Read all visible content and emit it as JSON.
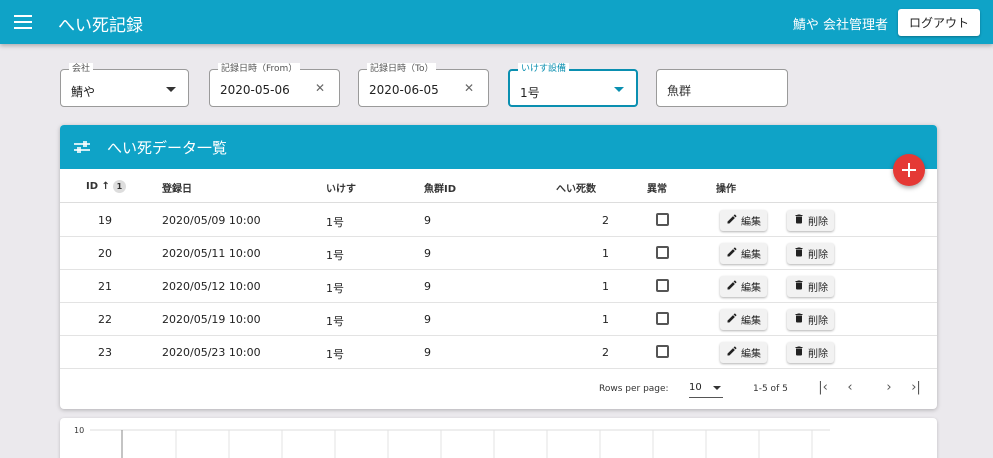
{
  "appbar": {
    "title": "へい死記録",
    "user": "鯖や 会社管理者",
    "logout_label": "ログアウト"
  },
  "filters": {
    "company": {
      "label": "会社",
      "value": "鯖や"
    },
    "date_from": {
      "label": "記録日時（From）",
      "value": "2020-05-06"
    },
    "date_to": {
      "label": "記録日時（To）",
      "value": "2020-06-05"
    },
    "pen": {
      "label": "いけす設備",
      "value": "1号"
    },
    "fish_group": {
      "placeholder": "魚群"
    }
  },
  "table": {
    "title": "へい死データ一覧",
    "columns": {
      "id": "ID",
      "sort_order": "1",
      "date": "登録日",
      "pen": "いけす",
      "fish_group": "魚群ID",
      "deaths": "へい死数",
      "abnormal": "異常",
      "actions": "操作"
    },
    "rows": [
      {
        "id": "19",
        "date": "2020/05/09 10:00",
        "pen": "1号",
        "fish_group": "9",
        "deaths": "2"
      },
      {
        "id": "20",
        "date": "2020/05/11 10:00",
        "pen": "1号",
        "fish_group": "9",
        "deaths": "1"
      },
      {
        "id": "21",
        "date": "2020/05/12 10:00",
        "pen": "1号",
        "fish_group": "9",
        "deaths": "1"
      },
      {
        "id": "22",
        "date": "2020/05/19 10:00",
        "pen": "1号",
        "fish_group": "9",
        "deaths": "1"
      },
      {
        "id": "23",
        "date": "2020/05/23 10:00",
        "pen": "1号",
        "fish_group": "9",
        "deaths": "2"
      }
    ],
    "edit_label": "編集",
    "delete_label": "削除",
    "pagination": {
      "rows_per_page_label": "Rows per page:",
      "rows_per_page": "10",
      "range": "1-5 of 5"
    }
  },
  "chart": {
    "y_tick": "10"
  },
  "colors": {
    "primary": "#0fa3c7",
    "fab": "#e53935"
  }
}
